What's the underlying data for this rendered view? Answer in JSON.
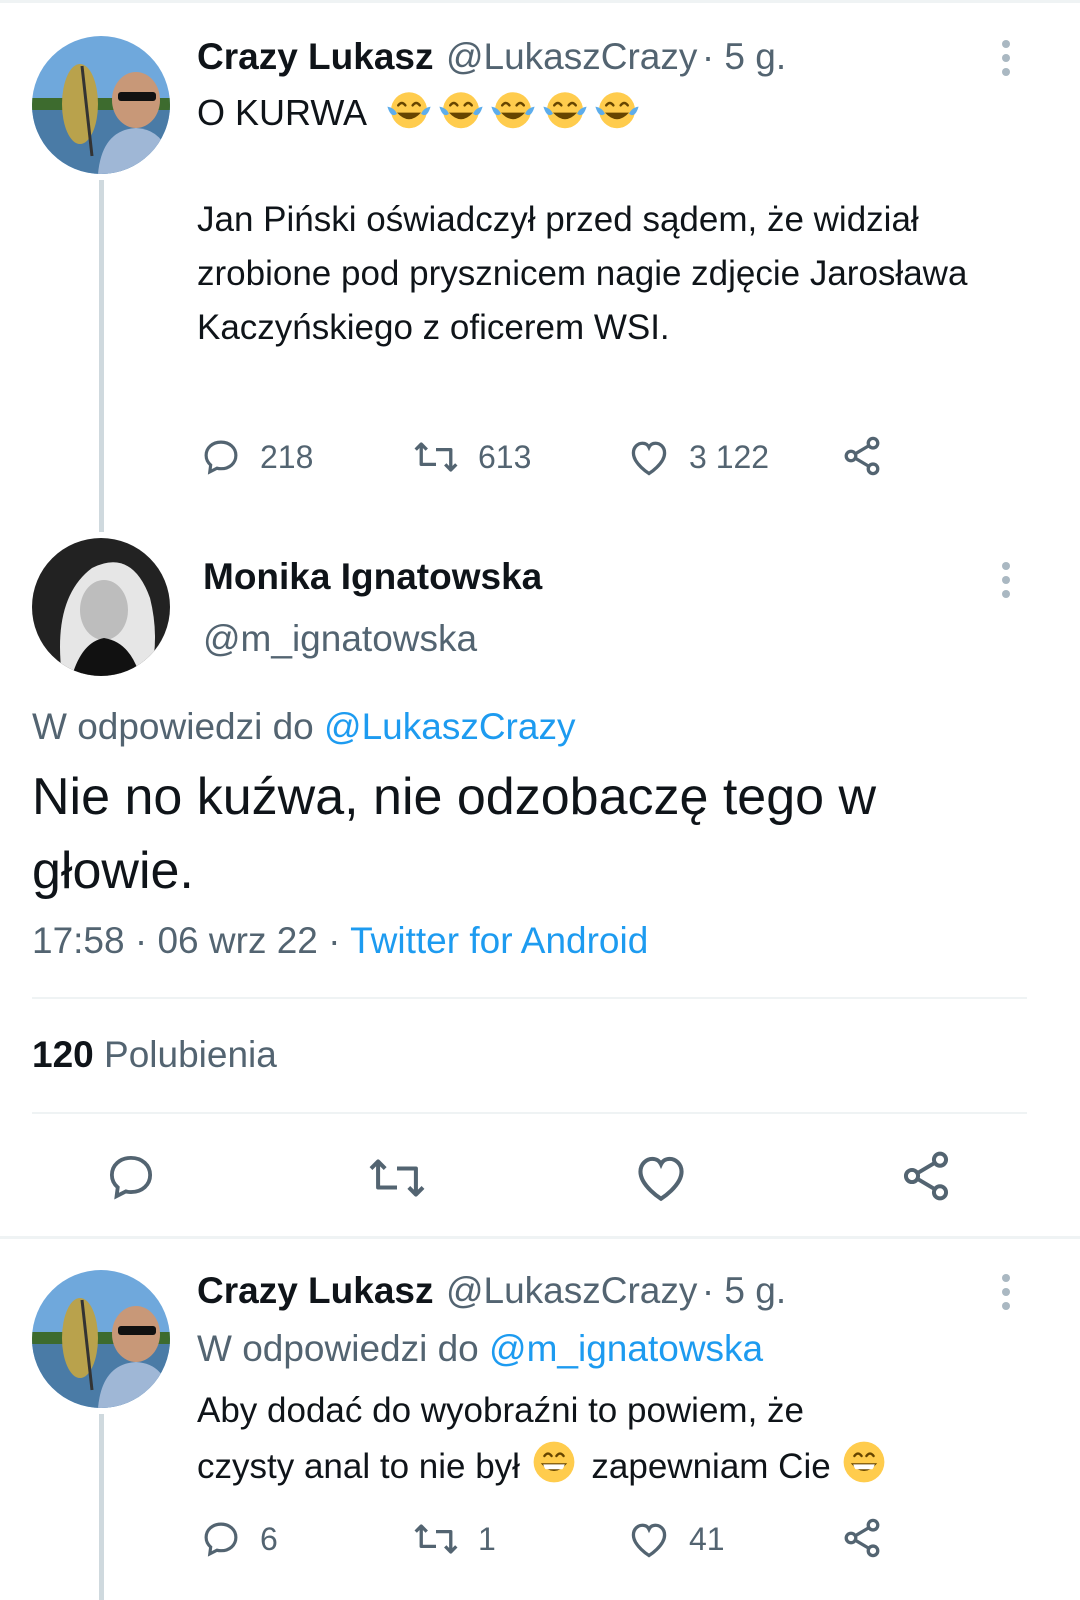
{
  "tweet1": {
    "name": "Crazy Lukasz",
    "handle": "@LukaszCrazy",
    "age": "· 5 g.",
    "headline": "O KURWA",
    "emoji_count": 5,
    "body": "Jan Piński oświadczył przed sądem, że widział zrobione pod prysznicem nagie zdjęcie Jarosława Kaczyńskiego z oficerem WSI.",
    "replies": "218",
    "retweets": "613",
    "likes": "3 122"
  },
  "main_tweet": {
    "name": "Monika Ignatowska",
    "handle": "@m_ignatowska",
    "reply_prefix": "W odpowiedzi do",
    "reply_to": "@LukaszCrazy",
    "text": "Nie no kuźwa, nie odzobaczę tego w głowie.",
    "time": "17:58 · 06 wrz 22 ·",
    "source": "Twitter for Android",
    "likes_count": "120",
    "likes_label": "Polubienia"
  },
  "tweet3": {
    "name": "Crazy Lukasz",
    "handle": "@LukaszCrazy",
    "age": "· 5 g.",
    "reply_prefix": "W odpowiedzi do",
    "reply_to": "@m_ignatowska",
    "line1": "Aby dodać do wyobraźni to powiem, że",
    "line2a": "czysty anal to nie był",
    "line2b": "zapewniam Cie",
    "replies": "6",
    "retweets": "1",
    "likes": "41"
  },
  "colors": {
    "text": "#0f1419",
    "secondary": "#536471",
    "link": "#1d9bf0",
    "thread_line": "#cfd9de",
    "divider": "#eff3f4"
  }
}
